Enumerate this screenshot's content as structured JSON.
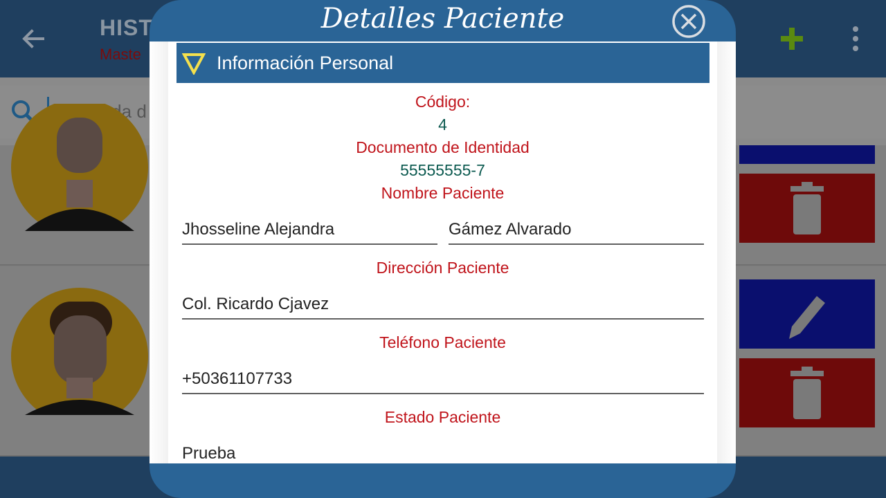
{
  "app_bar": {
    "title": "HISTO",
    "subtitle": "Maste",
    "back_icon": "arrow-left-icon",
    "add_icon": "plus-icon",
    "more_icon": "more-vertical-icon",
    "colors": {
      "background": "#1f3f5f",
      "add_icon": "#5a8a10"
    }
  },
  "search": {
    "value": "",
    "placeholder": "Busqueda d",
    "icon": "search-icon"
  },
  "patient_list": {
    "rows": [
      {
        "avatar_icon": "female-avatar-icon",
        "edit_icon": "pencil-icon",
        "delete_icon": "trash-icon"
      },
      {
        "avatar_icon": "male-avatar-icon",
        "edit_icon": "pencil-icon",
        "delete_icon": "trash-icon"
      }
    ]
  },
  "dialog": {
    "title": "Detalles Paciente",
    "close_icon": "close-circle-icon",
    "section": {
      "label": "Información Personal",
      "icon": "triangle-down-icon"
    },
    "fields": {
      "code_label": "Código:",
      "code_value": "4",
      "document_label": "Documento de Identidad",
      "document_value": "55555555-7",
      "name_label": "Nombre Paciente",
      "first_name": "Jhosseline Alejandra",
      "last_name": "Gámez Alvarado",
      "address_label": "Dirección Paciente",
      "address": "Col. Ricardo Cjavez",
      "phone_label": "Teléfono Paciente",
      "phone": "+50361107733",
      "status_label": "Estado Paciente",
      "status": "Prueba"
    },
    "colors": {
      "header": "#2a6496",
      "label_text": "#c0141b",
      "value_text": "#0c5a50",
      "triangle_icon": "#f4e04d"
    }
  }
}
